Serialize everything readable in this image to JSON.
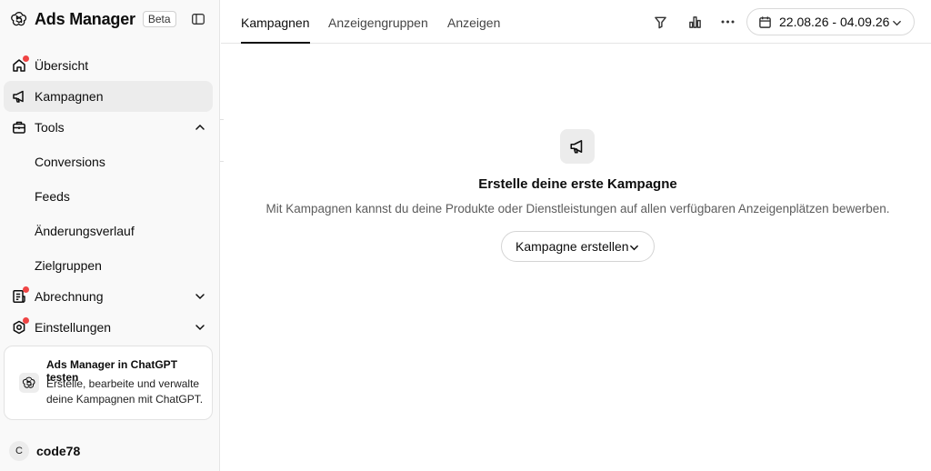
{
  "app": {
    "title": "Ads Manager",
    "badge": "Beta",
    "logo_icon": "openai-logo-icon",
    "collapse_icon": "sidebar-toggle-icon"
  },
  "sidebar": {
    "items": [
      {
        "label": "Übersicht",
        "icon": "home-icon",
        "notification_dot": true
      },
      {
        "label": "Kampagnen",
        "icon": "megaphone-icon",
        "active": true
      },
      {
        "label": "Tools",
        "icon": "toolbox-icon",
        "expanded": true
      },
      {
        "label": "Abrechnung",
        "icon": "receipt-icon",
        "notification_dot": true,
        "expanded": false
      },
      {
        "label": "Einstellungen",
        "icon": "gear-icon",
        "notification_dot": true,
        "expanded": false
      }
    ],
    "tools_subitems": [
      "Conversions",
      "Feeds",
      "Änderungsverlauf",
      "Zielgruppen"
    ]
  },
  "promo": {
    "title": "Ads Manager in ChatGPT testen",
    "text": "Erstelle, bearbeite und verwalte deine Kampagnen mit ChatGPT."
  },
  "user": {
    "initial": "C",
    "name": "code78"
  },
  "tabs": [
    {
      "label": "Kampagnen",
      "active": true
    },
    {
      "label": "Anzeigengruppen",
      "active": false
    },
    {
      "label": "Anzeigen",
      "active": false
    }
  ],
  "toolbar": {
    "icons": [
      "filter-icon",
      "bar-chart-icon",
      "more-icon"
    ],
    "date_range": "22.08.26 - 04.09.26"
  },
  "empty_state": {
    "icon": "megaphone-icon",
    "title": "Erstelle deine erste Kampagne",
    "text": "Mit Kampagnen kannst du deine Produkte oder Dienstleistungen auf allen verfügbaren Anzeigenplätzen bewerben.",
    "button": "Kampagne erstellen"
  },
  "colors": {
    "accent": "#0d0d0d",
    "notification": "#ef4444",
    "sidebar_bg": "#f9f9f9",
    "active_item_bg": "#ececec"
  }
}
